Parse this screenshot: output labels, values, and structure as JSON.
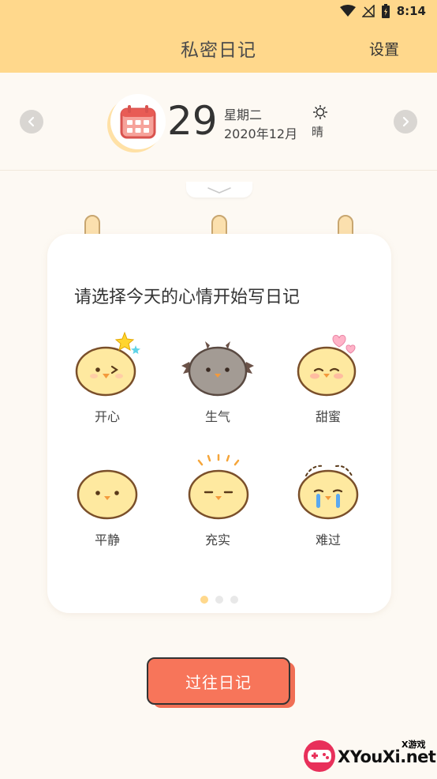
{
  "status": {
    "time": "8:14"
  },
  "header": {
    "title": "私密日记",
    "settings_label": "设置"
  },
  "date": {
    "day": "29",
    "weekday": "星期二",
    "year_month": "2020年12月",
    "weather": "晴"
  },
  "card": {
    "prompt": "请选择今天的心情开始写日记",
    "moods": [
      {
        "label": "开心",
        "icon": "happy-chick-icon"
      },
      {
        "label": "生气",
        "icon": "angry-chick-icon"
      },
      {
        "label": "甜蜜",
        "icon": "sweet-chick-icon"
      },
      {
        "label": "平静",
        "icon": "calm-chick-icon"
      },
      {
        "label": "充实",
        "icon": "fulfilled-chick-icon"
      },
      {
        "label": "难过",
        "icon": "sad-chick-icon"
      }
    ],
    "page_count": 3,
    "active_page": 1
  },
  "history_button": {
    "label": "过往日记"
  },
  "watermark": {
    "top": "X游戏",
    "main": "XYouXi.net"
  },
  "colors": {
    "header_bg": "#ffd88c",
    "button": "#f7755a",
    "background": "#fdf9f3"
  }
}
